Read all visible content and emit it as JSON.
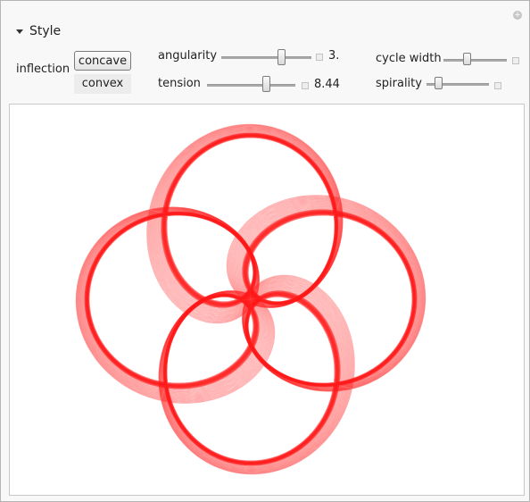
{
  "section": {
    "title": "Style"
  },
  "controls": {
    "inflection": {
      "label": "inflection",
      "options": [
        "concave",
        "convex"
      ],
      "selected": "concave"
    },
    "angularity": {
      "label": "angularity",
      "value": "3.",
      "position": 0.58
    },
    "tension": {
      "label": "tension",
      "value": "8.44",
      "position": 0.64
    },
    "cycle_width": {
      "label": "cycle width",
      "position": 0.23
    },
    "spirality": {
      "label": "spirality",
      "position": 0.12
    }
  },
  "plot": {
    "stroke_color": "#ff1a1a",
    "arms": 4
  }
}
